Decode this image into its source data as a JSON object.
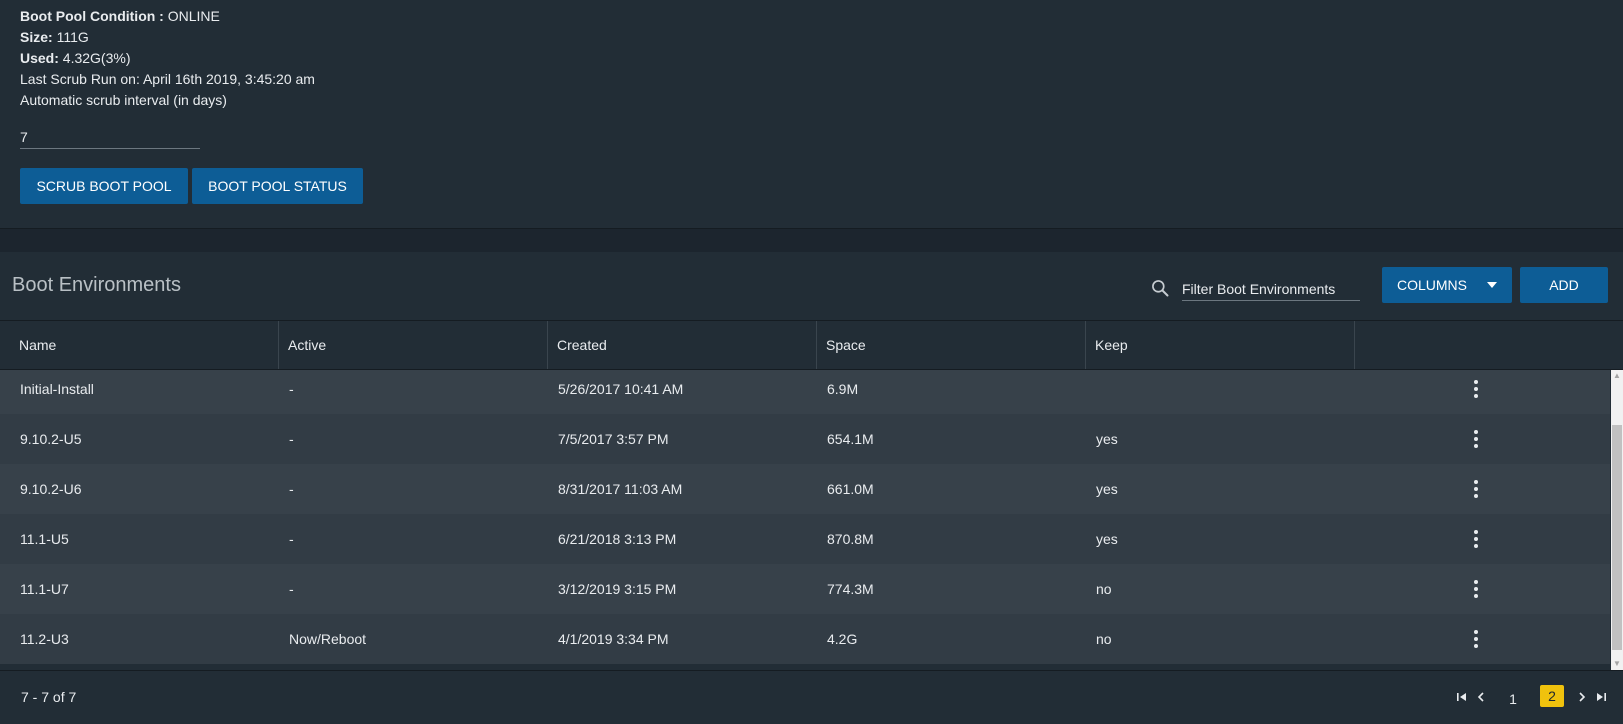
{
  "boot_pool": {
    "condition_label": "Boot Pool Condition :",
    "condition_value": "ONLINE",
    "size_label": "Size:",
    "size_value": "111G",
    "used_label": "Used:",
    "used_value": "4.32G(3%)",
    "last_scrub": "Last Scrub Run on: April 16th 2019, 3:45:20 am",
    "interval_label": "Automatic scrub interval (in days)",
    "interval_value": "7",
    "scrub_button": "SCRUB BOOT POOL",
    "status_button": "BOOT POOL STATUS"
  },
  "boot_envs": {
    "title": "Boot Environments",
    "filter_placeholder": "Filter Boot Environments",
    "columns_button": "COLUMNS",
    "add_button": "ADD",
    "headers": [
      "Name",
      "Active",
      "Created",
      "Space",
      "Keep"
    ],
    "rows": [
      {
        "name": "Initial-Install",
        "active": "-",
        "created": "5/26/2017 10:41 AM",
        "space": "6.9M",
        "keep": ""
      },
      {
        "name": "9.10.2-U5",
        "active": "-",
        "created": "7/5/2017 3:57 PM",
        "space": "654.1M",
        "keep": "yes"
      },
      {
        "name": "9.10.2-U6",
        "active": "-",
        "created": "8/31/2017 11:03 AM",
        "space": "661.0M",
        "keep": "yes"
      },
      {
        "name": "11.1-U5",
        "active": "-",
        "created": "6/21/2018 3:13 PM",
        "space": "870.8M",
        "keep": "yes"
      },
      {
        "name": "11.1-U7",
        "active": "-",
        "created": "3/12/2019 3:15 PM",
        "space": "774.3M",
        "keep": "no"
      },
      {
        "name": "11.2-U3",
        "active": "Now/Reboot",
        "created": "4/1/2019 3:34 PM",
        "space": "4.2G",
        "keep": "no"
      }
    ]
  },
  "pagination": {
    "range": "7 - 7 of 7",
    "pages": [
      "1",
      "2"
    ],
    "current_page": "2",
    "accent_color": "#f0c20d"
  },
  "icons": [
    "search-icon",
    "chevron-down-icon",
    "more-vert-icon",
    "first-page-icon",
    "chevron-left-icon",
    "chevron-right-icon",
    "last-page-icon"
  ],
  "colors": {
    "background": "#1c252e",
    "panel": "#222d36",
    "primary_button": "#0d5d96",
    "row_odd": "#37414a",
    "row_even": "#323c45"
  }
}
